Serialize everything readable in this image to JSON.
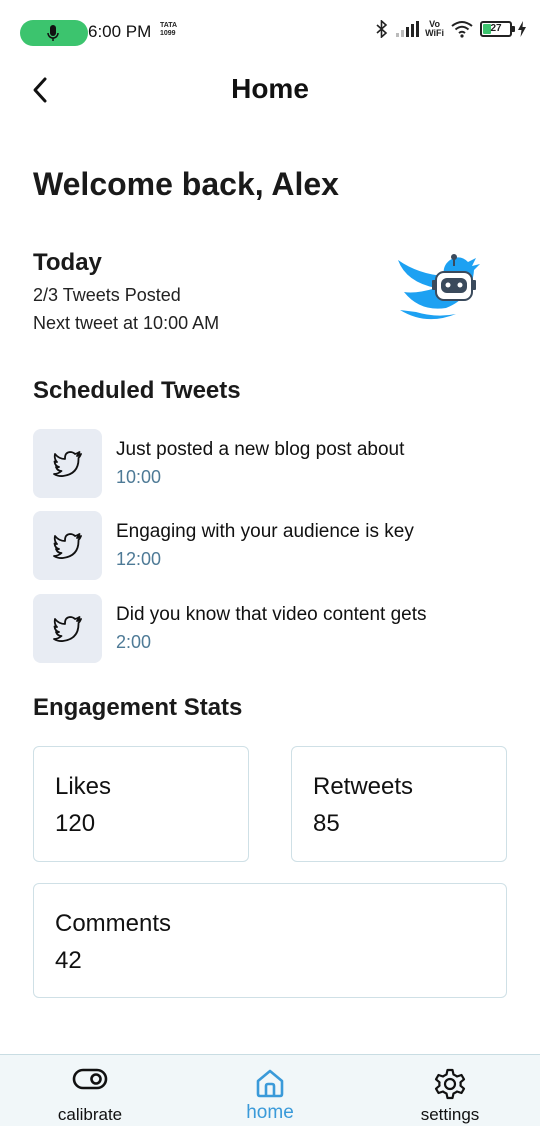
{
  "status_bar": {
    "time": "6:00 PM",
    "carrier_top": "TATA",
    "carrier_bottom": "1099",
    "vowifi_top": "Vo",
    "vowifi_bottom": "WiFi",
    "battery": "27",
    "battery_level": 0.27,
    "mic_color": "#3cc46e"
  },
  "header": {
    "title": "Home",
    "back_icon": "chevron-left-icon"
  },
  "welcome": "Welcome back, Alex",
  "today": {
    "title": "Today",
    "tweets_posted": "2/3 Tweets Posted",
    "next_tweet": "Next tweet at 10:00 AM"
  },
  "scheduled": {
    "title": "Scheduled Tweets",
    "items": [
      {
        "text": "Just posted a new blog post about",
        "time": "10:00"
      },
      {
        "text": "Engaging with your audience is key",
        "time": "12:00"
      },
      {
        "text": "Did you know that video content gets",
        "time": "2:00"
      }
    ]
  },
  "engagement": {
    "title": "Engagement Stats",
    "likes": {
      "label": "Likes",
      "value": "120"
    },
    "retweets": {
      "label": "Retweets",
      "value": "85"
    },
    "comments": {
      "label": "Comments",
      "value": "42"
    }
  },
  "nav": {
    "calibrate": "calibrate",
    "home": "home",
    "settings": "settings",
    "active": "home",
    "accent": "#3a9ad9"
  },
  "colors": {
    "twitter_blue": "#1da1f2",
    "time_text": "#4e7a96",
    "card_border": "#cfe0e6",
    "icon_box": "#e8ecf3"
  }
}
